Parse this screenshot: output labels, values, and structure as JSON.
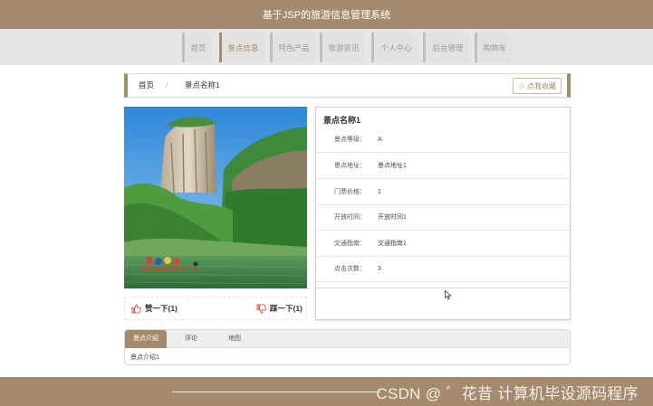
{
  "app": {
    "title": "基于JSP的旅游信息管理系统"
  },
  "nav": {
    "items": [
      {
        "label": "首页"
      },
      {
        "label": "景点信息"
      },
      {
        "label": "特色产品"
      },
      {
        "label": "旅游资讯"
      },
      {
        "label": "个人中心"
      },
      {
        "label": "后台管理"
      },
      {
        "label": "购物车"
      }
    ],
    "active_index": 1
  },
  "breadcrumb": {
    "home": "首页",
    "separator": "/",
    "current": "景点名称1",
    "favorite_button": "点我收藏"
  },
  "attraction": {
    "name": "景点名称1",
    "fields": [
      {
        "label": "景点等级：",
        "value": "A"
      },
      {
        "label": "景点地址：",
        "value": "景点地址1"
      },
      {
        "label": "门票价格：",
        "value": "1"
      },
      {
        "label": "开放时间：",
        "value": "开放时间1"
      },
      {
        "label": "交通指南：",
        "value": "交通指南1"
      },
      {
        "label": "点击次数：",
        "value": "3"
      }
    ]
  },
  "votes": {
    "like": "赞一下(1)",
    "dislike": "踩一下(1)"
  },
  "tabs": {
    "items": [
      {
        "label": "景点介绍"
      },
      {
        "label": "评论"
      },
      {
        "label": "地图"
      }
    ],
    "active_index": 0,
    "content": "景点介绍1"
  },
  "footer": {
    "watermark": "CSDN @ ゛花昔  计算机毕设源码程序"
  },
  "colors": {
    "brand": "#a58b6e",
    "nav_bg": "#e7e7e7",
    "like_icon": "#d9534f"
  }
}
